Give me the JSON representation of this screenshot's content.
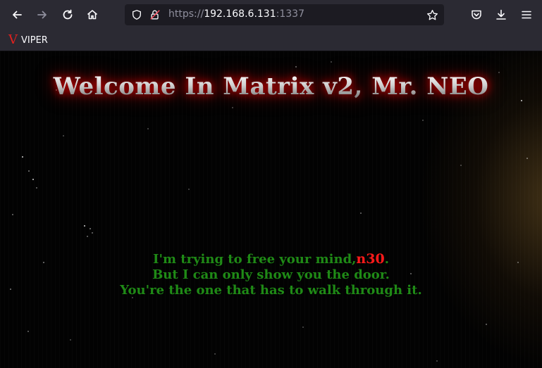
{
  "browser": {
    "url_prefix": "https://",
    "url_host": "192.168.6.131",
    "url_port": ":1337",
    "bookmark_label": "VIPER",
    "bookmark_icon_letter": "V"
  },
  "page": {
    "title": "Welcome In Matrix v2, Mr. NEO",
    "line1_start": "I'm trying to free your mind,",
    "line1_highlight": "n30",
    "line1_end": ".",
    "line2": "But I can only show you the door.",
    "line3": "You're the one that has to walk through it."
  },
  "colors": {
    "message_green": "#1f8a16",
    "highlight_red": "#ff1a1a",
    "title_glow": "#ff0000"
  }
}
